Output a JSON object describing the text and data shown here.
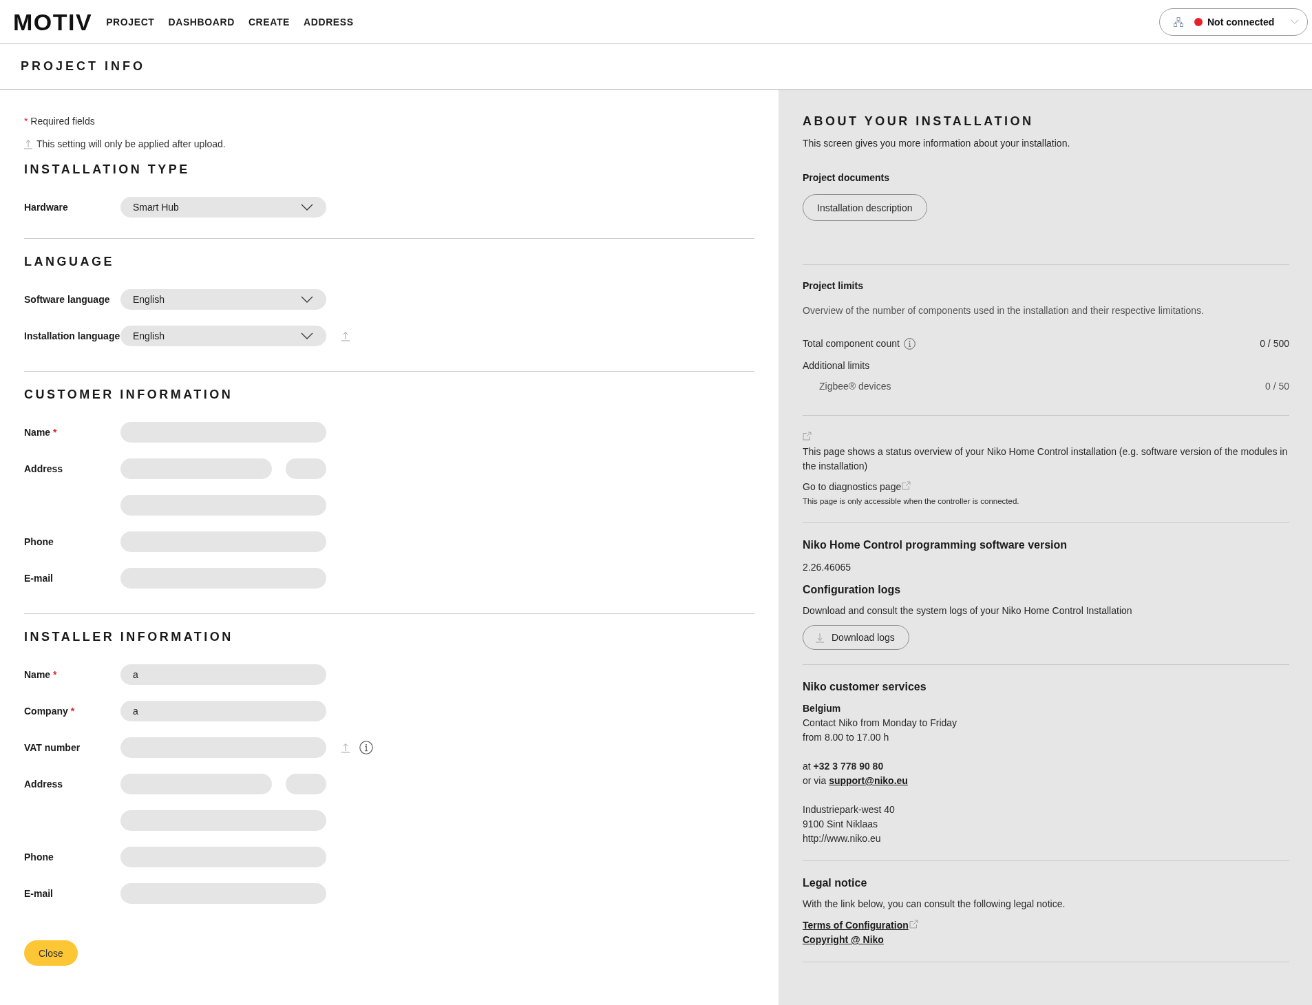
{
  "header": {
    "logo": "MOTIV",
    "nav": [
      "PROJECT",
      "DASHBOARD",
      "CREATE",
      "ADDRESS"
    ],
    "connection": {
      "label": "Not connected",
      "connected": false
    }
  },
  "page_title": "PROJECT INFO",
  "form": {
    "required_mark": "*",
    "required_note": "Required fields",
    "upload_note": "This setting will only be applied after upload.",
    "sections": [
      {
        "title": "INSTALLATION TYPE",
        "rows": [
          {
            "label": "Hardware",
            "kind": "dropdown",
            "value": "Smart Hub",
            "required": false,
            "upload": false,
            "info": false
          }
        ]
      },
      {
        "title": "LANGUAGE",
        "rows": [
          {
            "label": "Software language",
            "kind": "dropdown",
            "value": "English",
            "required": false,
            "upload": false,
            "info": false
          },
          {
            "label": "Installation language",
            "kind": "dropdown",
            "value": "English",
            "required": false,
            "upload": true,
            "info": false
          }
        ]
      },
      {
        "title": "CUSTOMER INFORMATION",
        "rows": [
          {
            "label": "Name",
            "kind": "text",
            "required": true,
            "upload": false,
            "info": false
          },
          {
            "label": "Address",
            "kind": "split",
            "required": false,
            "upload": false,
            "info": false
          },
          {
            "kind": "text",
            "required": false,
            "upload": false,
            "info": false
          },
          {
            "label": "Phone",
            "kind": "text",
            "required": false,
            "upload": false,
            "info": false
          },
          {
            "label": "E-mail",
            "kind": "text",
            "required": false,
            "upload": false,
            "info": false
          }
        ]
      },
      {
        "title": "INSTALLER INFORMATION",
        "rows": [
          {
            "label": "Name",
            "kind": "text",
            "value": "a",
            "required": true,
            "upload": false,
            "info": false
          },
          {
            "label": "Company",
            "kind": "text",
            "value": "a",
            "required": true,
            "upload": false,
            "info": false
          },
          {
            "label": "VAT number",
            "kind": "text",
            "required": false,
            "upload": true,
            "info": true
          },
          {
            "label": "Address",
            "kind": "split",
            "required": false,
            "upload": false,
            "info": false
          },
          {
            "kind": "text",
            "required": false,
            "upload": false,
            "info": false
          },
          {
            "label": "Phone",
            "kind": "text",
            "required": false,
            "upload": false,
            "info": false
          },
          {
            "label": "E-mail",
            "kind": "text",
            "required": false,
            "upload": false,
            "info": false
          }
        ]
      }
    ],
    "close_button": "Close"
  },
  "about": {
    "title": "ABOUT YOUR INSTALLATION",
    "intro": "This screen gives you more information about your installation.",
    "project_documents": {
      "heading": "Project documents",
      "button": "Installation description"
    },
    "project_limits": {
      "heading": "Project limits",
      "description": "Overview of the number of components used in the installation and their respective limitations.",
      "rows": [
        {
          "label": "Total component count",
          "value": "0 / 500",
          "info": true
        }
      ],
      "additional": {
        "heading": "Additional limits",
        "rows": [
          {
            "label": "Zigbee® devices",
            "value": "0 / 50",
            "info": false
          }
        ]
      }
    },
    "diagnostics": {
      "description": "This page shows a status overview of your Niko Home Control installation (e.g. software version of the modules in the installation)",
      "link": {
        "label": "Go to diagnostics page",
        "external": true
      },
      "note": "This page is only accessible when the controller is connected."
    },
    "software_version": {
      "heading": "Niko Home Control programming software version",
      "version": "2.26.46065"
    },
    "configuration_logs": {
      "heading": "Configuration logs",
      "description": "Download and consult the system logs of your Niko Home Control Installation",
      "button": "Download logs"
    },
    "customer_services": {
      "heading": "Niko customer services",
      "country": "Belgium",
      "hours": [
        "Contact Niko from Monday to Friday",
        "from 8.00 to 17.00 h"
      ],
      "phone": "at **+32 3 778 90 80**",
      "email_prefix": "or via",
      "email": "support@niko.eu",
      "address": [
        "Industriepark-west 40",
        "9100 Sint Niklaas",
        "http://www.niko.eu"
      ]
    },
    "legal": {
      "heading": "Legal notice",
      "description": "With the link below, you can consult the following legal notice.",
      "links": [
        {
          "label": "Terms of Configuration",
          "external": true
        },
        {
          "label": "Copyright @ Niko",
          "external": false
        }
      ]
    }
  }
}
